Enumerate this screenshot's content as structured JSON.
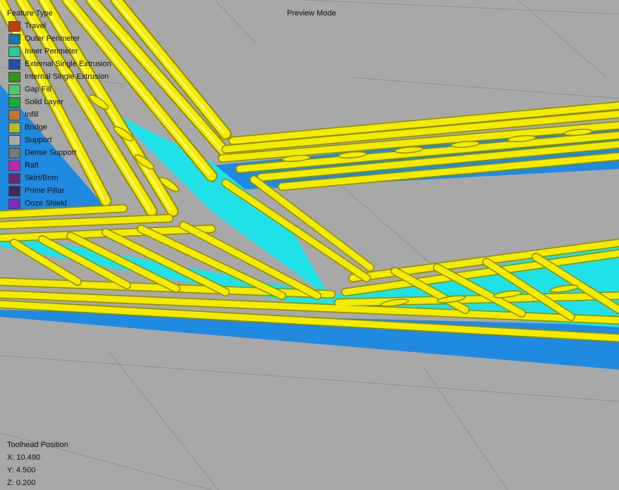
{
  "legend": {
    "title": "Feature Type",
    "items": [
      {
        "label": "Travel",
        "color": "#c0400c"
      },
      {
        "label": "Outer Perimeter",
        "color": "#1c78a6"
      },
      {
        "label": "Inner Perimeter",
        "color": "#2fc6a0"
      },
      {
        "label": "External Single Extrusion",
        "color": "#284ca8"
      },
      {
        "label": "Internal Single Extrusion",
        "color": "#2c9a1c"
      },
      {
        "label": "Gap Fill",
        "color": "#4cc870"
      },
      {
        "label": "Solid Layer",
        "color": "#1ea838"
      },
      {
        "label": "Infill",
        "color": "#c07830"
      },
      {
        "label": "Bridge",
        "color": "#b8b828"
      },
      {
        "label": "Support",
        "color": "#a8a8a8"
      },
      {
        "label": "Dense Support",
        "color": "#787878"
      },
      {
        "label": "Raft",
        "color": "#c028b0"
      },
      {
        "label": "Skirt/Brim",
        "color": "#6a2868"
      },
      {
        "label": "Prime Pillar",
        "color": "#3c2a58"
      },
      {
        "label": "Ooze Shield",
        "color": "#7a2cc0"
      }
    ]
  },
  "mode": {
    "label": "Preview Mode"
  },
  "toolhead": {
    "title": "Toolhead Position",
    "x": "X: 10.490",
    "y": "Y: 4.500",
    "z": "Z: 0.200"
  },
  "colors": {
    "background": "#a8a8a8",
    "grid": "#8e8e8e",
    "extrusion": "#f0e800",
    "extrusion_shadow": "#a0a000",
    "outer_edge": "#1f8ae0",
    "inner_fill": "#20e0e8"
  }
}
